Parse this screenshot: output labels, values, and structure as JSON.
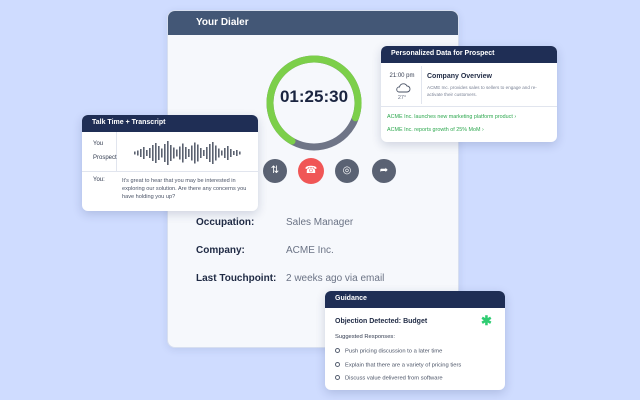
{
  "dialer": {
    "title": "Your Dialer",
    "timer": "01:25:30",
    "progress": 0.72,
    "controls": [
      {
        "name": "keypad-swap-icon",
        "glyph": "⇅"
      },
      {
        "name": "end-call-icon",
        "glyph": "☎"
      },
      {
        "name": "voicemail-icon",
        "glyph": "◎"
      },
      {
        "name": "forward-icon",
        "glyph": "➦"
      }
    ],
    "occupation_label": "Occupation:",
    "occupation_value": "Sales Manager",
    "company_label": "Company:",
    "company_value": "ACME Inc.",
    "touchpoint_label": "Last Touchpoint:",
    "touchpoint_value": "2 weeks ago via email",
    "colors": {
      "ring_green": "#7ccf4a",
      "ring_gray": "#6f7587",
      "end_call": "#f05656",
      "header": "#435776"
    }
  },
  "talk": {
    "title": "Talk Time + Transcript",
    "you_label": "You",
    "prospect_label": "Prospect",
    "speaker": "You:",
    "message": "It's great to hear that you may be interested in exploring our solution. Are there any concerns you have holding you up?"
  },
  "prospect_data": {
    "title": "Personalized Data for Prospect",
    "time": "21:00 pm",
    "weather_icon": "cloud-icon",
    "temperature": "27°",
    "company_title": "Company Overview",
    "company_desc": "ACME Inc. provides sales to sellers to engage and re-activate their customers.",
    "news": [
      "ACME Inc. launches new marketing platform product  ›",
      "ACME Inc. reports growth of 25% MoM  ›"
    ]
  },
  "guidance": {
    "title": "Guidance",
    "objection": "Objection Detected: Budget",
    "suggested_label": "Suggested Responses:",
    "responses": [
      "Push pricing discussion to a later time",
      "Explain that there are a variety of pricing tiers",
      "Discuss value delivered from software"
    ],
    "accent": "#2ecc71"
  }
}
